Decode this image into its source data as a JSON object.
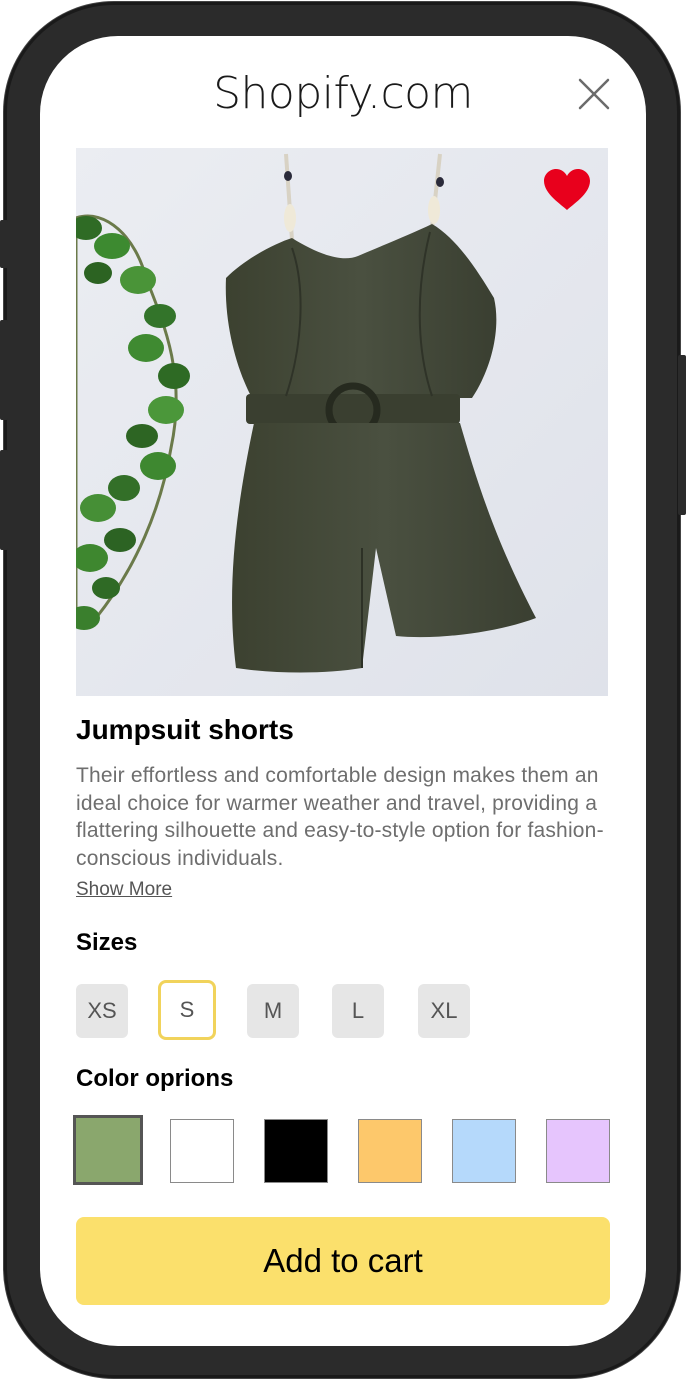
{
  "header": {
    "site_title": "Shopify.com"
  },
  "product": {
    "name": "Jumpsuit shorts",
    "description": "Their effortless and comfortable design makes them an ideal choice for warmer weather and travel, providing a flattering silhouette and easy-to-style option for fashion-conscious individuals.",
    "show_more_label": "Show More",
    "favorite_icon": "heart-icon",
    "favorite_color": "#e8001c"
  },
  "sizes": {
    "label": "Sizes",
    "options": [
      "XS",
      "S",
      "M",
      "L",
      "XL"
    ],
    "selected": "S"
  },
  "colors": {
    "label": "Color oprions",
    "options": [
      "#8aa76d",
      "#ffffff",
      "#000000",
      "#fdc86b",
      "#b5d9fb",
      "#e6c5fd"
    ],
    "selected": "#8aa76d"
  },
  "cart": {
    "button_label": "Add to cart",
    "button_color": "#fbe06c"
  }
}
